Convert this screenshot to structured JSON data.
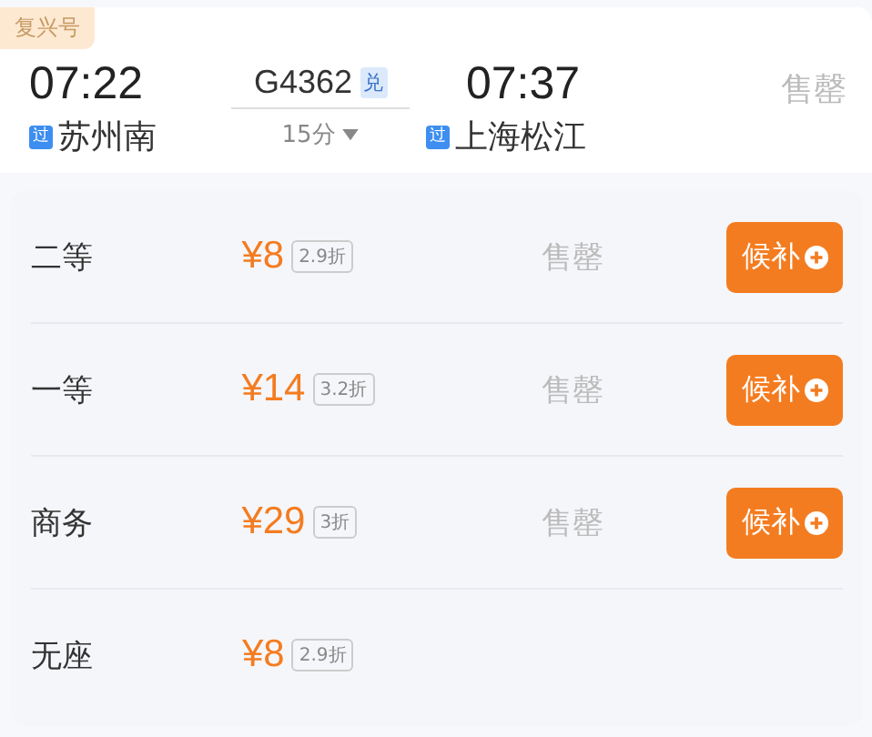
{
  "train": {
    "badge": "复兴号",
    "depart_time": "07:22",
    "depart_station": "苏州南",
    "depart_station_tag": "过",
    "number": "G4362",
    "number_tag": "兑",
    "duration": "15分",
    "arrive_time": "07:37",
    "arrive_station": "上海松江",
    "arrive_station_tag": "过",
    "status": "售罄"
  },
  "seats": [
    {
      "name": "二等",
      "price": "¥8",
      "discount": "2.9折",
      "status": "售罄",
      "button": "候补"
    },
    {
      "name": "一等",
      "price": "¥14",
      "discount": "3.2折",
      "status": "售罄",
      "button": "候补"
    },
    {
      "name": "商务",
      "price": "¥29",
      "discount": "3折",
      "status": "售罄",
      "button": "候补"
    },
    {
      "name": "无座",
      "price": "¥8",
      "discount": "2.9折"
    }
  ]
}
